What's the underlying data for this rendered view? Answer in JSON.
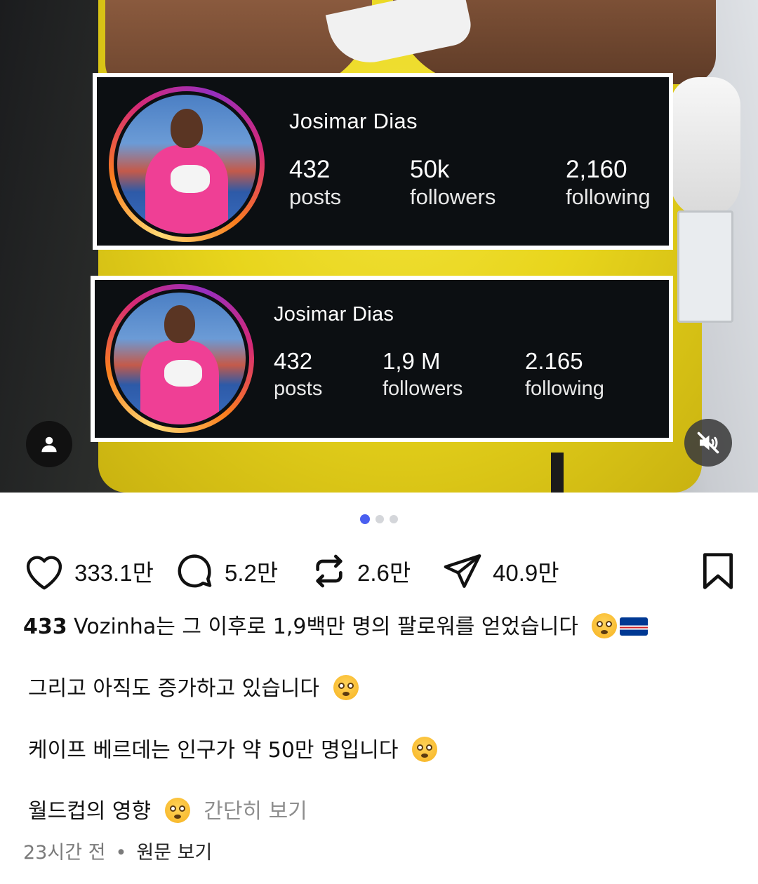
{
  "media": {
    "card_top": {
      "name": "Josimar Dias",
      "stats": [
        {
          "value": "432",
          "label": "posts"
        },
        {
          "value": "50k",
          "label": "followers"
        },
        {
          "value": "2,160",
          "label": "following"
        }
      ]
    },
    "card_bottom": {
      "name": "Josimar Dias",
      "stats": [
        {
          "value": "432",
          "label": "posts"
        },
        {
          "value": "1,9 M",
          "label": "followers"
        },
        {
          "value": "2.165",
          "label": "following"
        }
      ]
    },
    "carousel": {
      "count": 3,
      "active_index": 0
    },
    "icons": {
      "tag": "person-icon",
      "mute": "speaker-muted-icon"
    }
  },
  "actions": {
    "like_count": "333.1만",
    "comment_count": "5.2만",
    "repost_count": "2.6만",
    "share_count": "40.9만"
  },
  "caption": {
    "username": "433",
    "line1": " Vozinha는 그 이후로 1,9백만 명의 팔로워를 얻었습니다",
    "line2": "그리고 아직도 증가하고 있습니다",
    "line3": "케이프 베르데는 인구가 약 50만 명입니다",
    "line4": "월드컵의 영향",
    "more_label": "간단히 보기"
  },
  "meta": {
    "time_ago": "23시간 전",
    "separator": "•",
    "original_label": "원문 보기"
  },
  "colors": {
    "accent": "#4a5ff0",
    "card_bg": "#0c0f12",
    "muted_text": "#8e8e8e"
  }
}
